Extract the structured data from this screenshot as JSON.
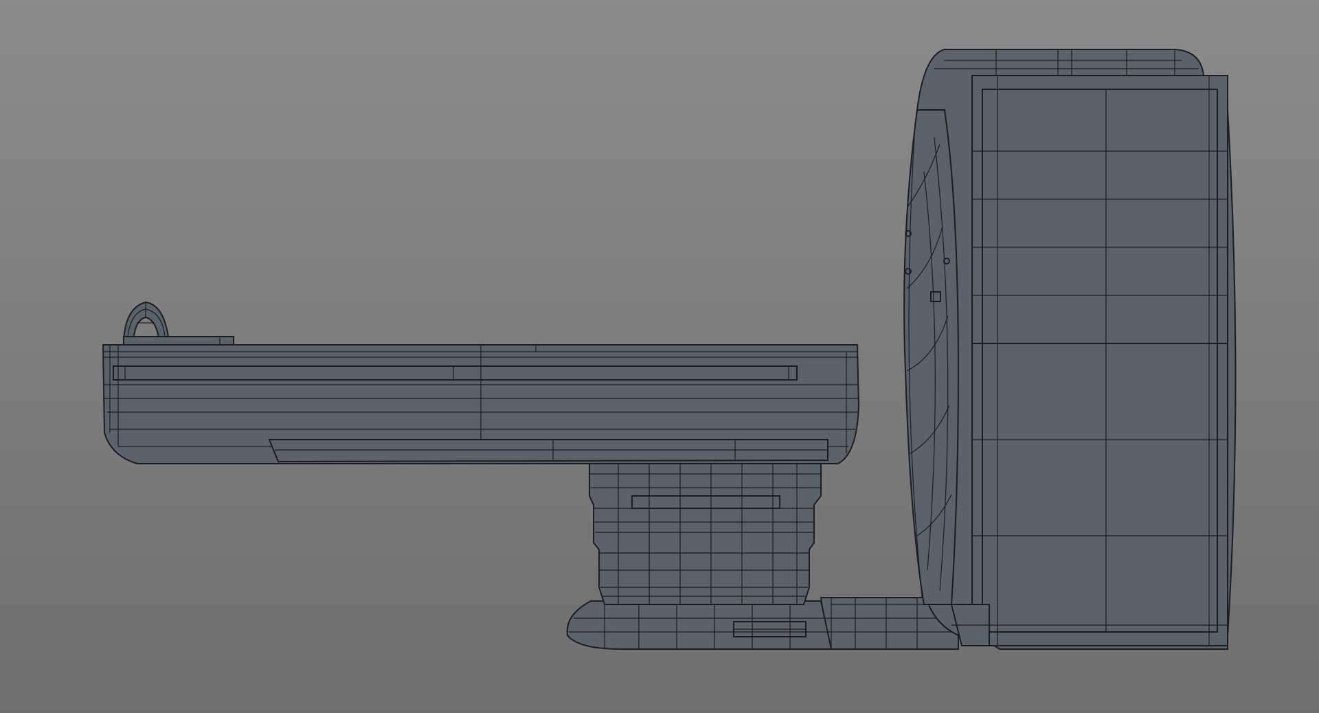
{
  "scene": {
    "subject": "ct-scanner-wireframe-side-view",
    "colors": {
      "background_top": "#8b8b8b",
      "background_bottom": "#6f6f6f",
      "model_body": "#5b626b",
      "model_shade": "#4e545c",
      "wire_lines": "#1b1d20"
    },
    "parts": [
      "patient-table",
      "table-head-ring",
      "table-pedestal",
      "floor-base",
      "gantry",
      "gantry-bore",
      "floor-rail"
    ]
  }
}
